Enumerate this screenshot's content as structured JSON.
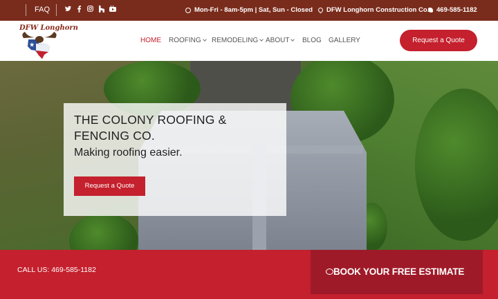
{
  "topbar": {
    "faq_label": "FAQ",
    "social_icons": [
      "twitter-icon",
      "facebook-icon",
      "instagram-icon",
      "houzz-icon",
      "youtube-icon"
    ],
    "hours": "Mon-Fri - 8am-5pm | Sat, Sun - Closed",
    "company": "DFW Longhorn Construction Co.",
    "phone": "469-585-1182"
  },
  "brand": {
    "logo_text": "DFW Longhorn",
    "accent_color": "#c4202d",
    "topbar_color": "#7a2c1c"
  },
  "nav": {
    "items": [
      {
        "label": "HOME",
        "active": true,
        "dropdown": false
      },
      {
        "label": "ROOFING",
        "active": false,
        "dropdown": true
      },
      {
        "label": "REMODELING",
        "active": false,
        "dropdown": true
      },
      {
        "label": "ABOUT",
        "active": false,
        "dropdown": true
      },
      {
        "label": "BLOG",
        "active": false,
        "dropdown": false
      },
      {
        "label": "GALLERY",
        "active": false,
        "dropdown": false
      }
    ],
    "cta_label": "Request a Quote"
  },
  "hero": {
    "title": "THE COLONY ROOFING & FENCING CO.",
    "subtitle": "Making roofing easier.",
    "button_label": "Request a Quote"
  },
  "footer_bar": {
    "call_label": "CALL US: 469-585-1182",
    "estimate_label": "BOOK YOUR FREE ESTIMATE"
  }
}
